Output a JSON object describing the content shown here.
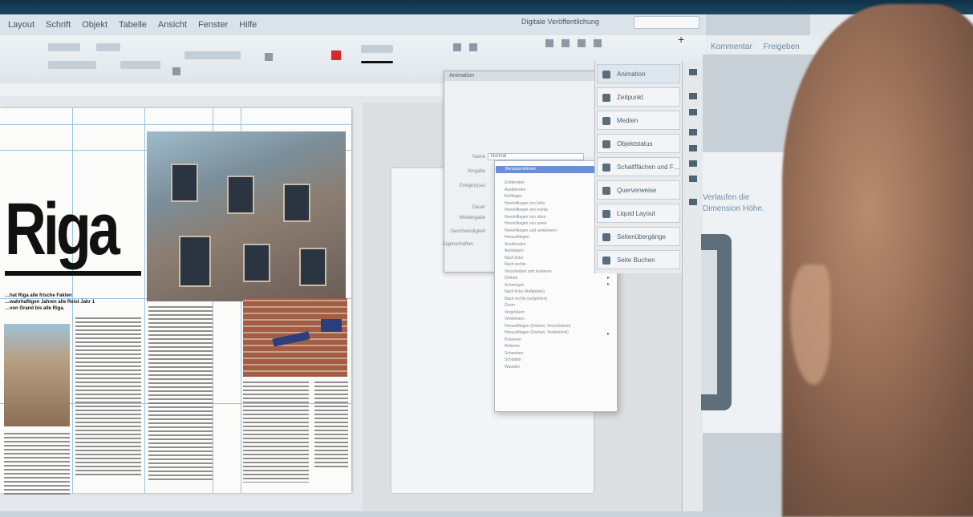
{
  "menubar": {
    "items": [
      "Layout",
      "Schrift",
      "Objekt",
      "Tabelle",
      "Ansicht",
      "Fenster",
      "Hilfe"
    ],
    "workspace": "Digitale Veröffentlichung"
  },
  "sharebar": {
    "comment": "Kommentar",
    "share": "Freigeben"
  },
  "document": {
    "headline": "Riga",
    "caption_lines": [
      "…hat Riga alle frische Fakten",
      "…wahrhaftigen Jahren alle Reist Jahr 1",
      "…von Grand bis alle Riga."
    ]
  },
  "panel": {
    "title": "Animation",
    "fields": [
      {
        "label": "Name",
        "value": "Normal"
      },
      {
        "label": "Vorgabe",
        "value": "Benutzerdefiniert"
      }
    ],
    "other_labels": [
      "Ereignis(se)",
      "Dauer",
      "Wiedergabe",
      "Geschwindigkeit"
    ],
    "properties_label": "Eigenschaften"
  },
  "dropdown": {
    "items": [
      "Einblenden",
      "Ausblenden",
      "Einfliegen",
      "Hereinfliegen von links",
      "Hereinfliegen von rechts",
      "Hereinfliegen von oben",
      "Hereinfliegen von unten",
      "Hereinfliegen und verkleinern",
      "Herausfliegen",
      "Ausblenden",
      "Aufsteigen",
      "Nach links",
      "Nach rechts",
      "Verschieben und skalieren",
      "Drehen",
      "Schwingen",
      "Nach links (Aufgleiten)",
      "Nach rechts (aufgleiten)",
      "Zoom",
      "Vergrößern",
      "Verkleinern",
      "Herausfliegen (Drehen, Verschieben)",
      "Herausfliegen (Drehen, Verkleinern)",
      "Pulsieren",
      "Rotieren",
      "Schweben",
      "Schütteln",
      "Wackeln"
    ]
  },
  "buttons": [
    {
      "label": "Animation",
      "icon": "animation-icon"
    },
    {
      "label": "Zeitpunkt",
      "icon": "timing-icon"
    },
    {
      "label": "Medien",
      "icon": "media-icon"
    },
    {
      "label": "Objektstatus",
      "icon": "object-states-icon"
    },
    {
      "label": "Schaltflächen und F…",
      "icon": "buttons-forms-icon"
    },
    {
      "label": "Querverweise",
      "icon": "cross-ref-icon"
    },
    {
      "label": "Liquid Layout",
      "icon": "liquid-layout-icon"
    },
    {
      "label": "Seitenübergänge",
      "icon": "page-transitions-icon"
    },
    {
      "label": "Seite Buchen",
      "icon": "book-icon"
    }
  ],
  "preview": {
    "line1": "Verlaufen die",
    "line2": "Dimension Höhe."
  },
  "colors": {
    "accent_red": "#d62a2a",
    "selection_blue": "#6b8fd4",
    "guide_blue": "#9fc3de"
  }
}
